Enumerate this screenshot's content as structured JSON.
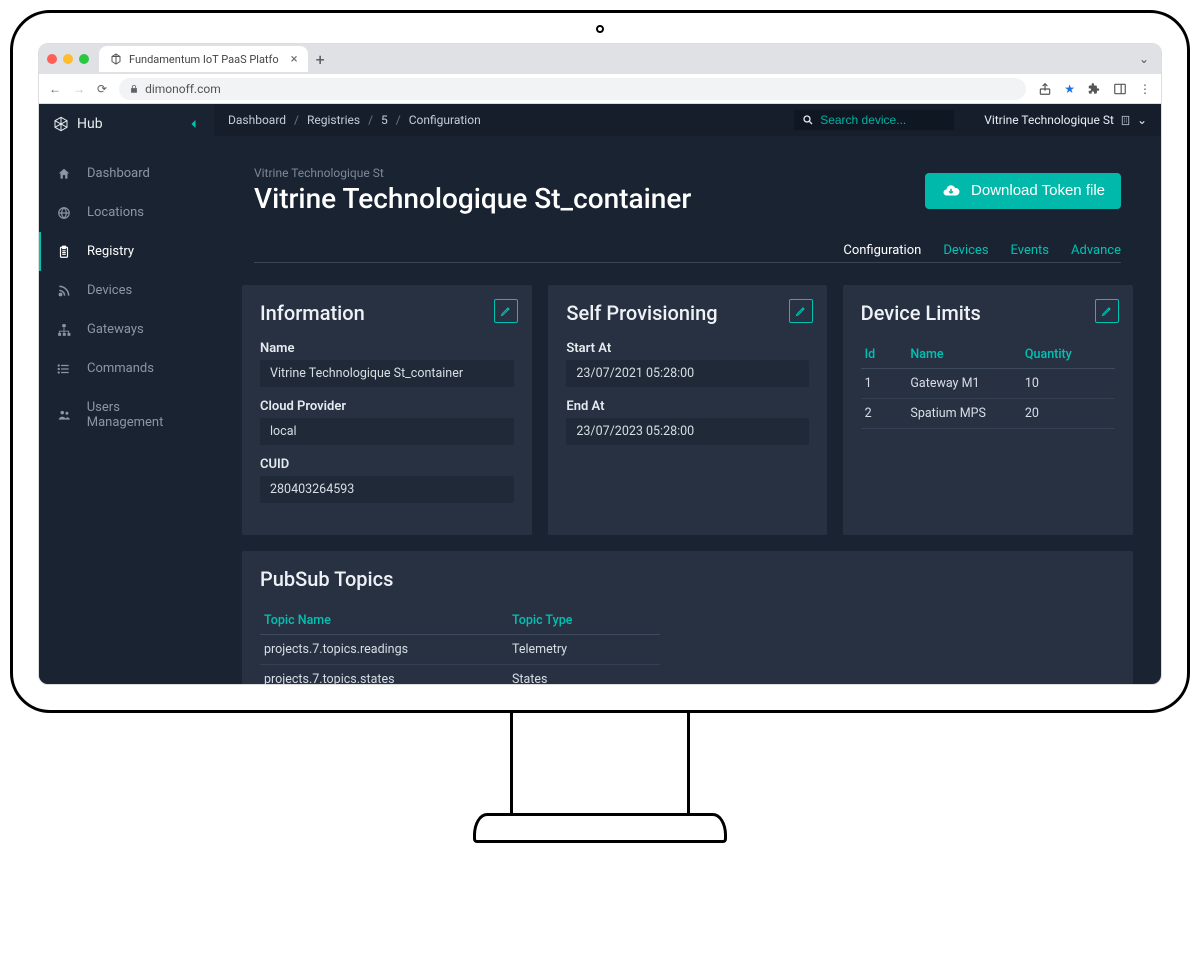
{
  "browser": {
    "tab_title": "Fundamentum IoT PaaS Platfo",
    "url": "dimonoff.com"
  },
  "sidebar": {
    "brand": "Hub",
    "items": [
      {
        "label": "Dashboard"
      },
      {
        "label": "Locations"
      },
      {
        "label": "Registry"
      },
      {
        "label": "Devices"
      },
      {
        "label": "Gateways"
      },
      {
        "label": "Commands"
      },
      {
        "label": "Users Management"
      }
    ]
  },
  "topbar": {
    "crumbs": [
      "Dashboard",
      "Registries",
      "5",
      "Configuration"
    ],
    "search_placeholder": "Search device...",
    "account": "Vitrine Technologique St"
  },
  "page": {
    "supertitle": "Vitrine Technologique St",
    "title": "Vitrine Technologique St_container",
    "download_btn": "Download Token file",
    "tabs": [
      "Configuration",
      "Devices",
      "Events",
      "Advance"
    ]
  },
  "information": {
    "title": "Information",
    "name_label": "Name",
    "name_value": "Vitrine Technologique St_container",
    "cloud_label": "Cloud Provider",
    "cloud_value": "local",
    "cuid_label": "CUID",
    "cuid_value": "280403264593"
  },
  "self_provisioning": {
    "title": "Self Provisioning",
    "start_label": "Start At",
    "start_value": "23/07/2021 05:28:00",
    "end_label": "End At",
    "end_value": "23/07/2023 05:28:00"
  },
  "device_limits": {
    "title": "Device Limits",
    "headers": [
      "Id",
      "Name",
      "Quantity"
    ],
    "rows": [
      {
        "id": "1",
        "name": "Gateway M1",
        "qty": "10"
      },
      {
        "id": "2",
        "name": "Spatium MPS",
        "qty": "20"
      }
    ]
  },
  "pubsub": {
    "title": "PubSub Topics",
    "headers": [
      "Topic Name",
      "Topic Type"
    ],
    "rows": [
      {
        "name": "projects.7.topics.readings",
        "type": "Telemetry"
      },
      {
        "name": "projects.7.topics.states",
        "type": "States"
      }
    ]
  }
}
